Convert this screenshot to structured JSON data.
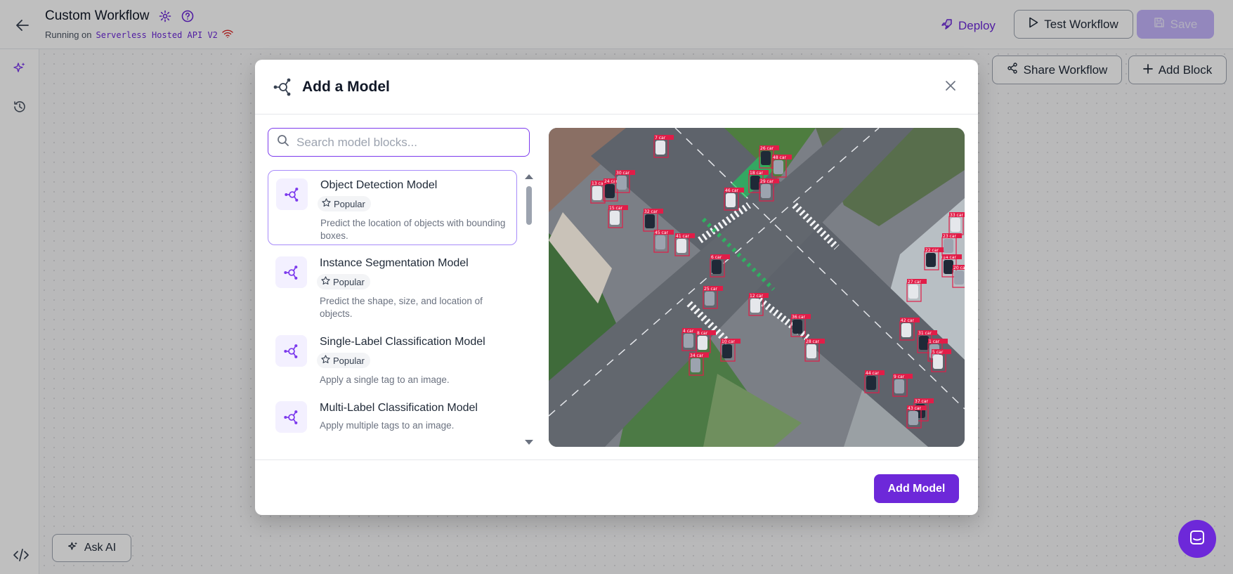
{
  "header": {
    "title": "Custom Workflow",
    "running_prefix": "Running on",
    "running_target": "Serverless Hosted API V2",
    "deploy_label": "Deploy",
    "test_label": "Test Workflow",
    "save_label": "Save"
  },
  "canvas": {
    "share_label": "Share Workflow",
    "add_block_label": "Add Block",
    "ask_ai_label": "Ask AI"
  },
  "modal": {
    "title": "Add a Model",
    "search_placeholder": "Search model blocks...",
    "search_value": "",
    "items": [
      {
        "title": "Object Detection Model",
        "badge": "Popular",
        "description": "Predict the location of objects with bounding boxes.",
        "selected": true
      },
      {
        "title": "Instance Segmentation Model",
        "badge": "Popular",
        "description": "Predict the shape, size, and location of objects.",
        "selected": false
      },
      {
        "title": "Single-Label Classification Model",
        "badge": "Popular",
        "description": "Apply a single tag to an image.",
        "selected": false
      },
      {
        "title": "Multi-Label Classification Model",
        "badge": "",
        "description": "Apply multiple tags to an image.",
        "selected": false
      }
    ],
    "add_button_label": "Add Model"
  },
  "preview": {
    "detection_labels": [
      "13 car",
      "24 car",
      "30 car",
      "7 car",
      "26 car",
      "48 car",
      "15 car",
      "18 car",
      "29 car",
      "46 car",
      "32 car",
      "45 car",
      "41 car",
      "6 car",
      "25 car",
      "12 car",
      "36 car",
      "4 car",
      "8 car",
      "10 car",
      "34 car",
      "28 car",
      "44 car",
      "9 car",
      "42 car",
      "31 car",
      "1 car",
      "5 car",
      "37 car",
      "43 car",
      "33 car",
      "14 car",
      "20 car",
      "27 car",
      "22 car",
      "23 car"
    ]
  },
  "colors": {
    "accent": "#6d28d9",
    "accent_light": "#c4b5fd",
    "badge_bg": "#f3f4f6",
    "detection_box": "#e11d48"
  }
}
